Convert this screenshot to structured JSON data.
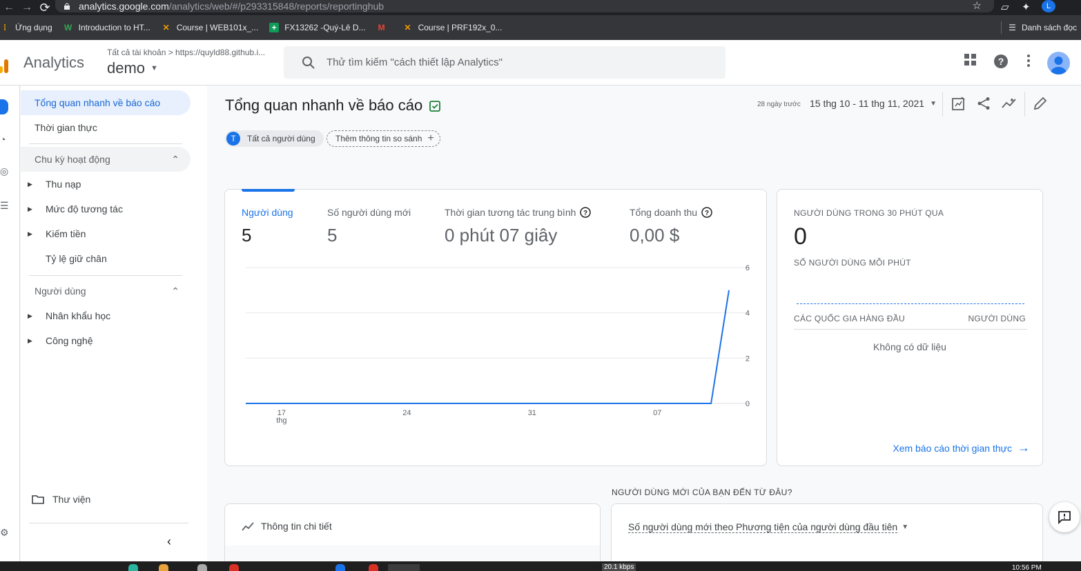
{
  "browser": {
    "url_host": "analytics.google.com",
    "url_path": "/analytics/web/#/p293315848/reports/reportinghub",
    "profile_initial": "L"
  },
  "bookmarks": {
    "items": [
      {
        "label": "Ứng dụng",
        "icon": "apps-grid-icon"
      },
      {
        "label": "Introduction to HT...",
        "icon": "w-logo-icon"
      },
      {
        "label": "Course | WEB101x_...",
        "icon": "course-x-icon"
      },
      {
        "label": "FX13262 -Quý-Lê D...",
        "icon": "sheets-icon"
      },
      {
        "label": "",
        "icon": "gmail-icon"
      },
      {
        "label": "Course | PRF192x_0...",
        "icon": "course-x-icon"
      }
    ],
    "reading_list": "Danh sách đọc"
  },
  "header": {
    "app_name": "Analytics",
    "breadcrumb": "Tất cả tài khoản > https://quyld88.github.i...",
    "property": "demo",
    "search_placeholder": "Thử tìm kiếm \"cách thiết lập Analytics\""
  },
  "nav": {
    "active": "Tổng quan nhanh về báo cáo",
    "realtime": "Thời gian thực",
    "lifecycle": "Chu kỳ hoạt động",
    "acquisition": "Thu nạp",
    "engagement": "Mức độ tương tác",
    "monetization": "Kiếm tiền",
    "retention": "Tỷ lệ giữ chân",
    "user": "Người dùng",
    "demographics": "Nhân khẩu học",
    "tech": "Công nghệ",
    "library": "Thư viện"
  },
  "page": {
    "title": "Tổng quan nhanh về báo cáo",
    "date_hint": "28 ngày trước",
    "date_range": "15 thg 10 - 11 thg 11, 2021",
    "chip_all_badge": "T",
    "chip_all": "Tất cả người dùng",
    "chip_add": "Thêm thông tin so sánh"
  },
  "metrics": [
    {
      "label": "Người dùng",
      "value": "5"
    },
    {
      "label": "Số người dùng mới",
      "value": "5"
    },
    {
      "label": "Thời gian tương tác trung bình",
      "value": "0 phút 07 giây"
    },
    {
      "label": "Tổng doanh thu",
      "value": "0,00 $"
    }
  ],
  "chart_data": {
    "type": "line",
    "x": [
      1,
      2,
      3,
      4,
      5,
      6,
      7,
      8,
      9,
      10,
      11,
      12,
      13,
      14,
      15,
      16,
      17,
      18,
      19,
      20,
      21,
      22,
      23,
      24,
      25,
      26,
      27,
      28
    ],
    "x_tick_labels": [
      "17",
      "24",
      "31",
      "07"
    ],
    "x_tick_sublabel": "thg",
    "series": [
      {
        "values": [
          0,
          0,
          0,
          0,
          0,
          0,
          0,
          0,
          0,
          0,
          0,
          0,
          0,
          0,
          0,
          0,
          0,
          0,
          0,
          0,
          0,
          0,
          0,
          0,
          0,
          0,
          0,
          5
        ]
      }
    ],
    "y_ticks": [
      "0",
      "2",
      "4",
      "6"
    ],
    "ylim": [
      0,
      6
    ],
    "grid": true,
    "color": "#1a73e8"
  },
  "realtime": {
    "title": "NGƯỜI DÙNG TRONG 30 PHÚT QUA",
    "count": "0",
    "per_minute": "SỐ NGƯỜI DÙNG MỖI PHÚT",
    "col_country": "CÁC QUỐC GIA HÀNG ĐẦU",
    "col_users": "NGƯỜI DÙNG",
    "no_data": "Không có dữ liệu",
    "link": "Xem báo cáo thời gian thực"
  },
  "bottom": {
    "question": "NGƯỜI DÙNG MỚI CỦA BẠN ĐẾN TỪ ĐÂU?",
    "insights": "Thông tin chi tiết",
    "source_dropdown": "Số người dùng mới theo Phương tiện của người dùng đầu tiên"
  },
  "taskbar": {
    "speed": "20.1 kbps",
    "clock": "10:56 PM"
  },
  "colors": {
    "accent": "#1a73e8",
    "active_bg": "#e8f0fe",
    "ga_orange": "#f9ab00"
  }
}
